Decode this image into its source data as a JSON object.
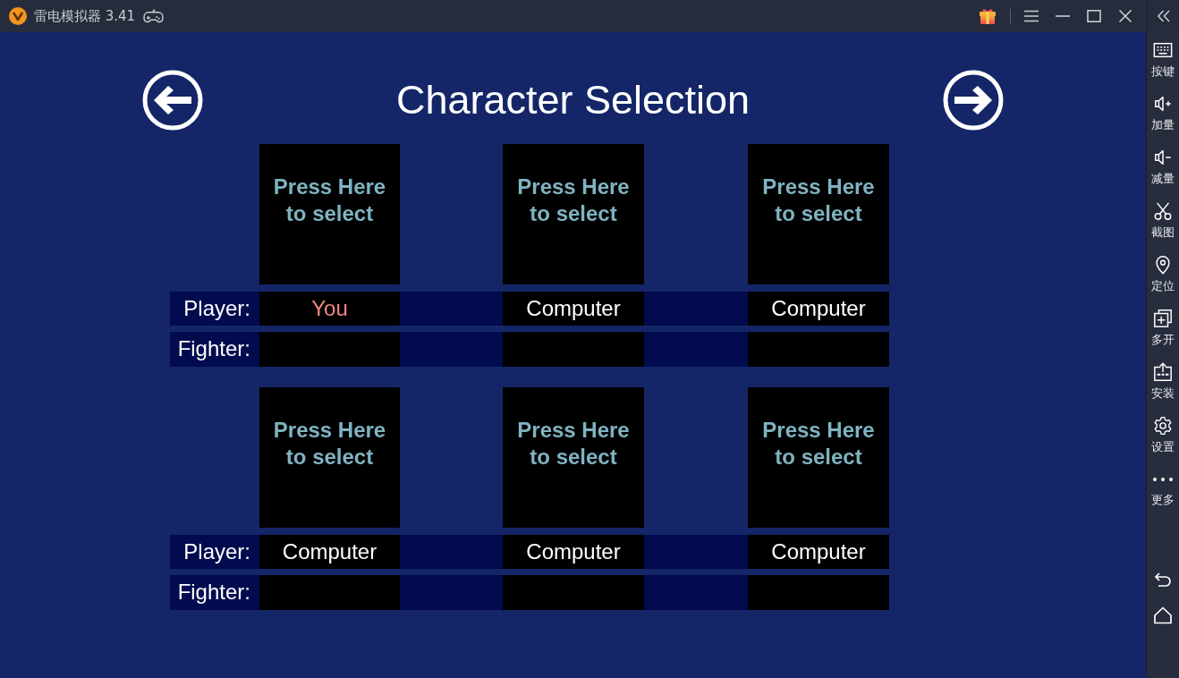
{
  "window": {
    "title": "雷电模拟器 3.41"
  },
  "sidebar": {
    "items": [
      {
        "label": "按键"
      },
      {
        "label": "加量"
      },
      {
        "label": "减量"
      },
      {
        "label": "截图"
      },
      {
        "label": "定位"
      },
      {
        "label": "多开"
      },
      {
        "label": "安装"
      },
      {
        "label": "设置"
      },
      {
        "label": "更多"
      }
    ]
  },
  "screen": {
    "title": "Character Selection",
    "groups": [
      {
        "player_label": "Player:",
        "fighter_label": "Fighter:",
        "slots": [
          {
            "prompt": "Press **Here** to select",
            "player": {
              "name": "You",
              "kind": "human"
            }
          },
          {
            "prompt": "Press **Here** to select",
            "player": {
              "name": "Computer",
              "kind": "computer"
            }
          },
          {
            "prompt": "Press **Here** to select",
            "player": {
              "name": "Computer",
              "kind": "computer"
            }
          }
        ]
      },
      {
        "player_label": "Player:",
        "fighter_label": "Fighter:",
        "slots": [
          {
            "prompt": "Press **Here** to select",
            "player": {
              "name": "Computer",
              "kind": "computer"
            }
          },
          {
            "prompt": "Press **Here** to select",
            "player": {
              "name": "Computer",
              "kind": "computer"
            }
          },
          {
            "prompt": "Press **Here** to select",
            "player": {
              "name": "Computer",
              "kind": "computer"
            }
          }
        ]
      }
    ]
  }
}
